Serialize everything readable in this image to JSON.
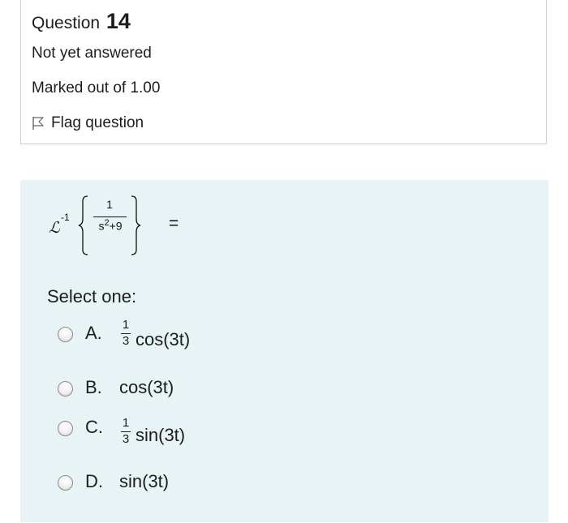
{
  "info": {
    "question_word": "Question",
    "question_number": "14",
    "status": "Not yet answered",
    "marks": "Marked out of 1.00",
    "flag_label": "Flag question"
  },
  "question": {
    "operator": "ℒ",
    "inverse": "-1",
    "numerator": "1",
    "denominator_base": "s",
    "denominator_exp": "2",
    "denominator_rest": "+9",
    "equals": "="
  },
  "prompt": "Select one:",
  "options": [
    {
      "letter": "A.",
      "frac_num": "1",
      "frac_den": "3",
      "text": "cos(3t)"
    },
    {
      "letter": "B.",
      "text": "cos(3t)"
    },
    {
      "letter": "C.",
      "frac_num": "1",
      "frac_den": "3",
      "text": "sin(3t)"
    },
    {
      "letter": "D.",
      "text": "sin(3t)"
    }
  ],
  "colors": {
    "content_background": "#e7f3f5",
    "border": "#cfcfcf"
  }
}
